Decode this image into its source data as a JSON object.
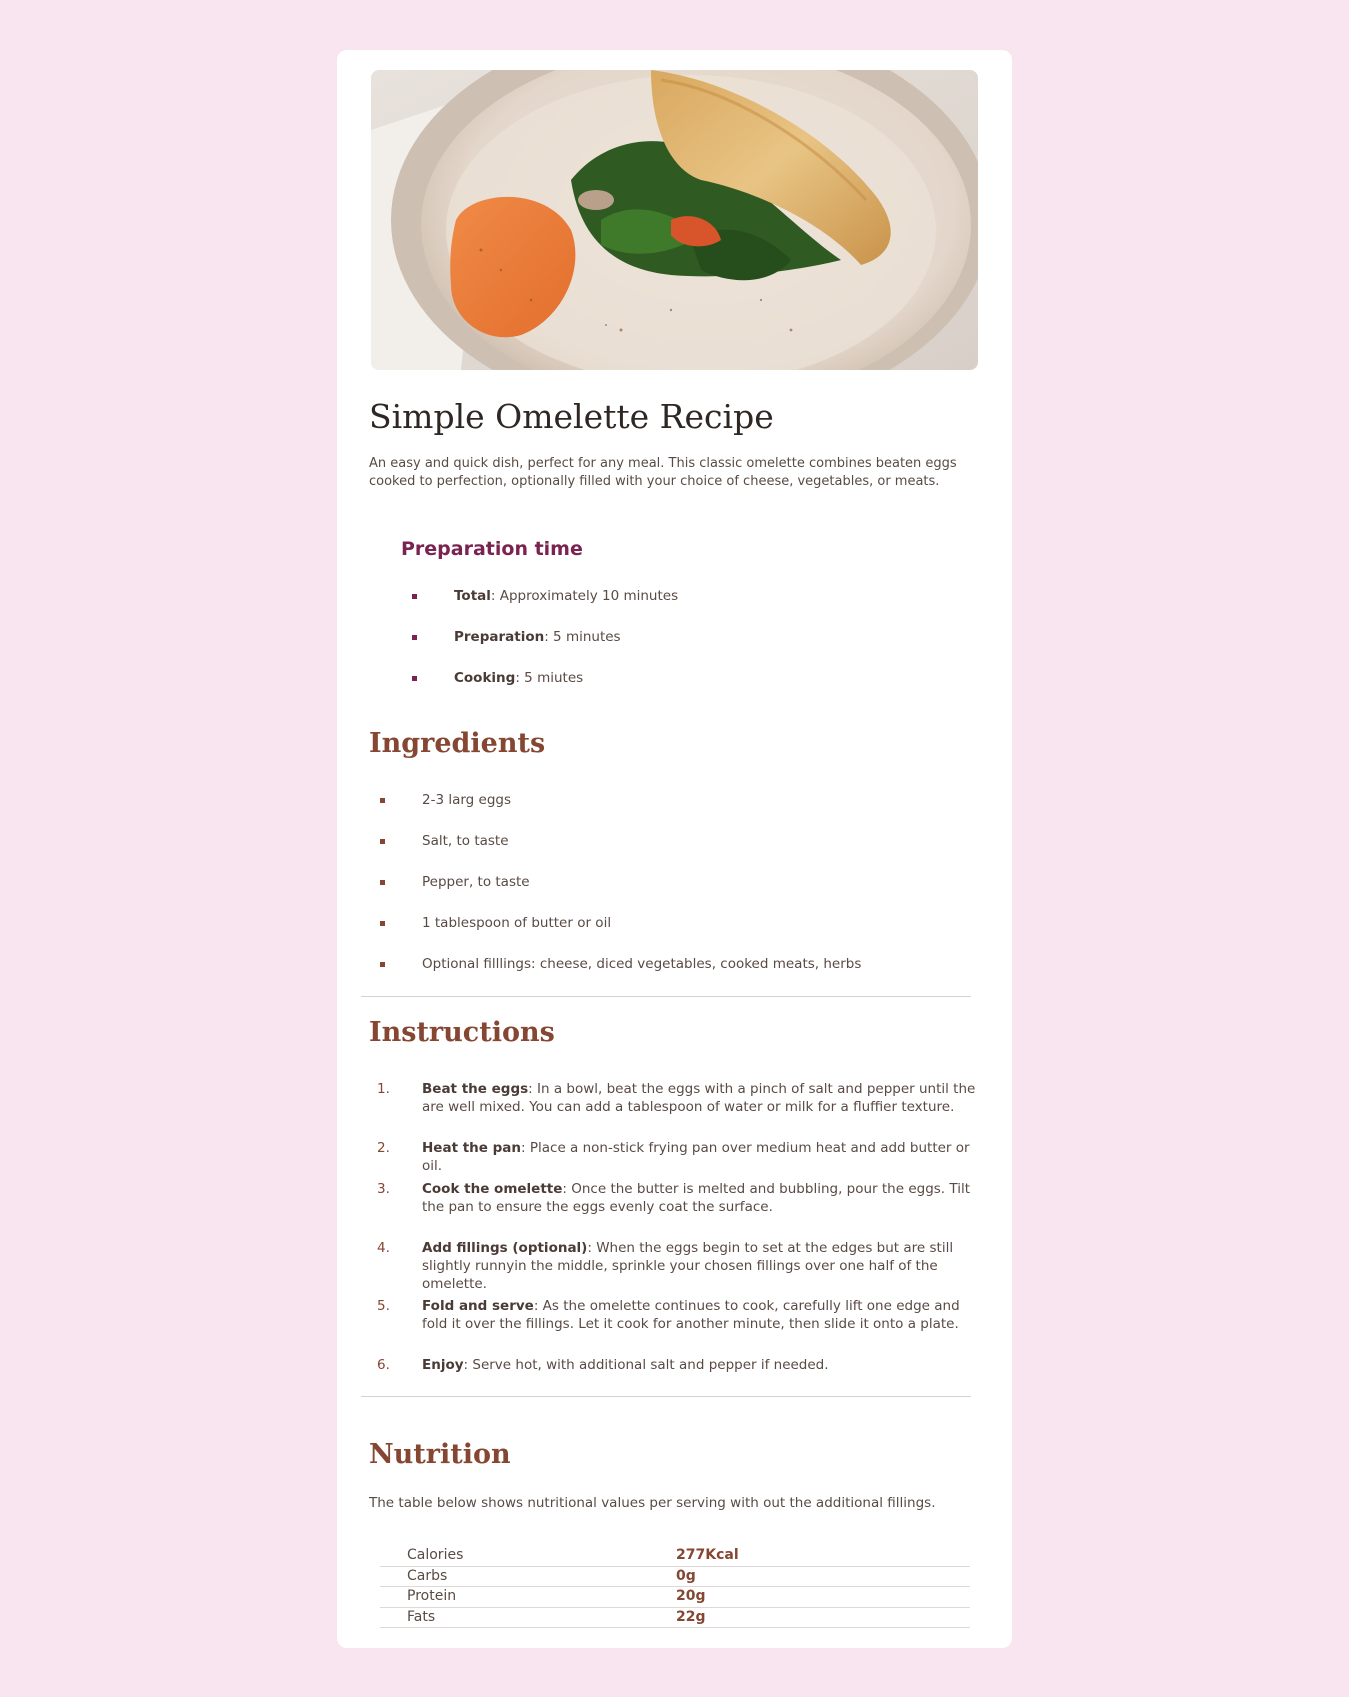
{
  "recipe": {
    "title": "Simple Omelette Recipe",
    "intro": "An easy and quick dish, perfect for any meal. This classic omelette combines beaten eggs cooked to perfection, optionally filled with your choice of cheese, vegetables, or meats."
  },
  "preparation": {
    "title": "Preparation time",
    "items": [
      {
        "label": "Total",
        "text": ": Approximately 10 minutes"
      },
      {
        "label": "Preparation",
        "text": ": 5 minutes"
      },
      {
        "label": "Cooking",
        "text": ": 5 miutes"
      }
    ]
  },
  "ingredients": {
    "title": "Ingredients",
    "items": [
      "2-3 larg eggs",
      "Salt, to taste",
      "Pepper, to taste",
      "1 tablespoon of butter or oil",
      "Optional filllings: cheese, diced vegetables, cooked meats, herbs"
    ]
  },
  "instructions": {
    "title": "Instructions",
    "steps": [
      {
        "num": "1.",
        "label": "Beat the eggs",
        "text": ": In a bowl, beat the eggs with a pinch of salt and pepper until the are well mixed. You can add a tablespoon of water or milk for a fluffier texture."
      },
      {
        "num": "2.",
        "label": "Heat the pan",
        "text": ": Place a non-stick frying pan over medium heat and add butter or oil."
      },
      {
        "num": "3.",
        "label": "Cook the omelette",
        "text": ": Once the butter is melted and bubbling, pour the eggs. Tilt the pan to ensure the eggs evenly coat the surface."
      },
      {
        "num": "4.",
        "label": "Add fillings (optional)",
        "text": ": When the eggs begin to set at the edges but are still slightly runnyin the middle, sprinkle your chosen fillings over one half of the omelette."
      },
      {
        "num": "5.",
        "label": "Fold and serve",
        "text": ": As the omelette continues to cook, carefully lift one edge and fold it over the fillings. Let it cook for another minute, then slide it onto a plate."
      },
      {
        "num": "6.",
        "label": "Enjoy",
        "text": ": Serve hot, with additional salt and pepper if needed."
      }
    ]
  },
  "nutrition": {
    "title": "Nutrition",
    "intro": "The table below shows nutritional values per serving with out the additional fillings.",
    "rows": [
      {
        "label": "Calories",
        "value": "277Kcal"
      },
      {
        "label": "Carbs",
        "value": "0g"
      },
      {
        "label": "Protein",
        "value": "20g"
      },
      {
        "label": "Fats",
        "value": "22g"
      }
    ]
  },
  "colors": {
    "page_background": "#f9e5ef",
    "card_background": "#ffffff",
    "accent_brown": "#854632",
    "accent_purple": "#7a2350",
    "title_dark": "#2f2724",
    "body_text": "#5a4a44"
  }
}
